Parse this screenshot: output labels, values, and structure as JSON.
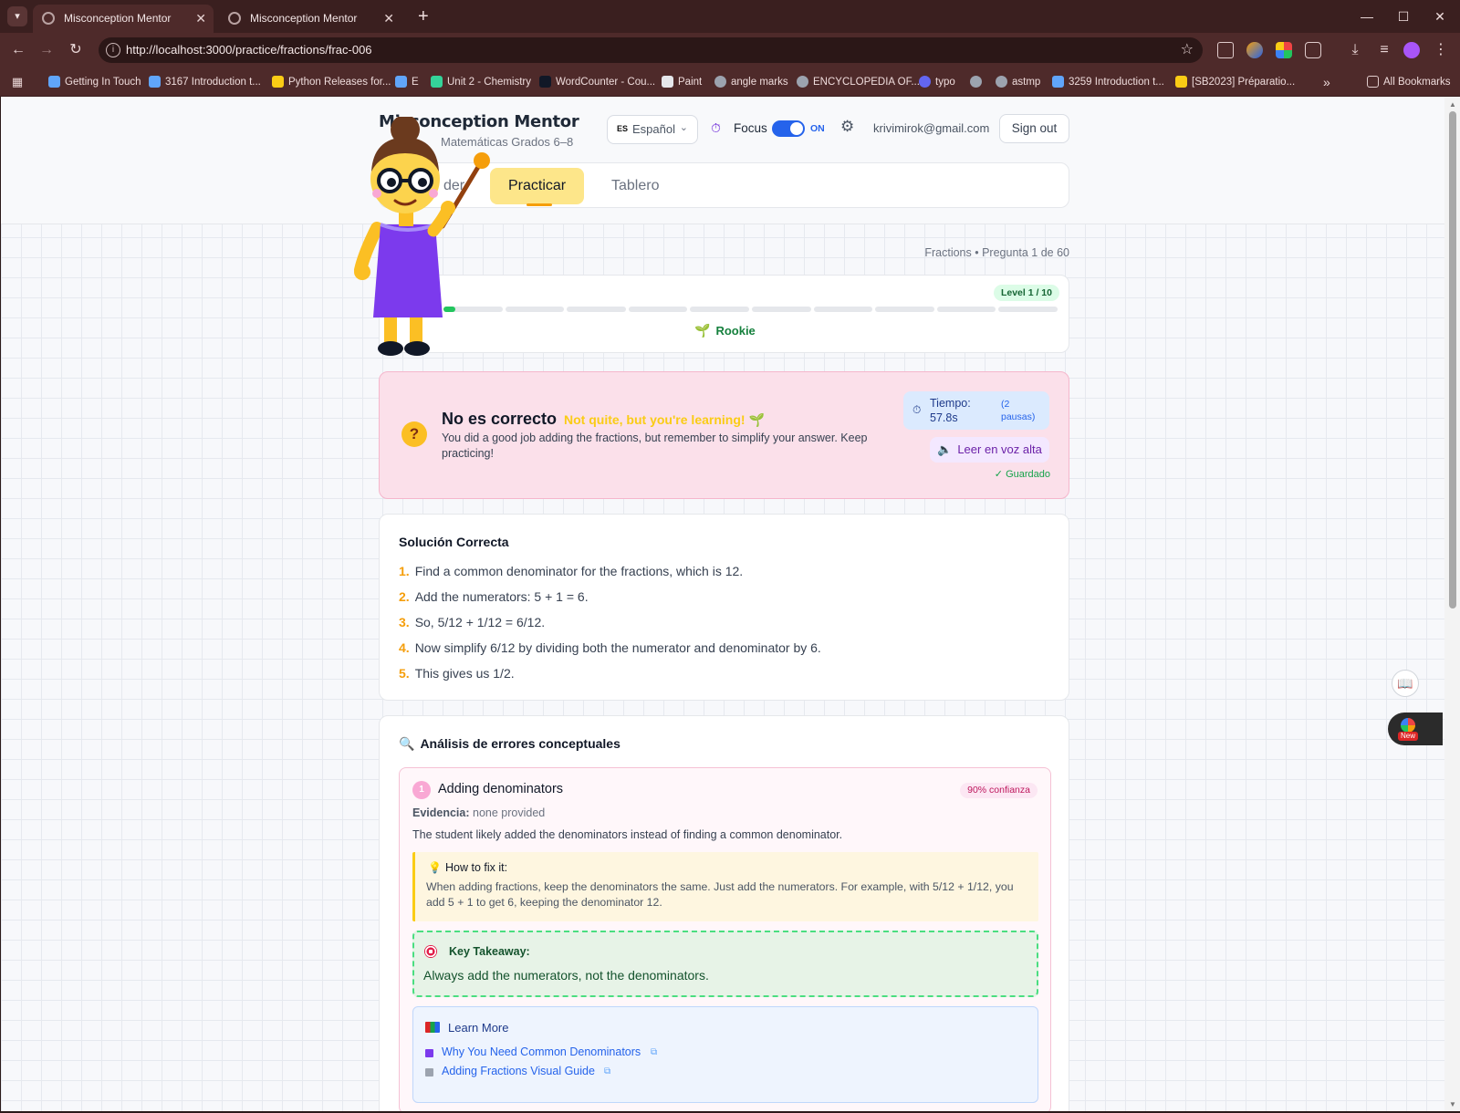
{
  "browser": {
    "tabs": [
      {
        "title": "Misconception Mentor",
        "active": true
      },
      {
        "title": "Misconception Mentor",
        "active": false
      }
    ],
    "url": "http://localhost:3000/practice/fractions/frac-006",
    "bookmarks": [
      {
        "label": "Getting In Touch",
        "color": "#60a5fa"
      },
      {
        "label": "3167 Introduction t...",
        "color": "#60a5fa"
      },
      {
        "label": "Python Releases for...",
        "color": "#facc15"
      },
      {
        "label": "E",
        "color": "#60a5fa"
      },
      {
        "label": "Unit 2 - Chemistry",
        "color": "#34d399"
      },
      {
        "label": "WordCounter - Cou...",
        "color": "#111827"
      },
      {
        "label": "Paint",
        "color": "#e5e7eb"
      },
      {
        "label": "angle marks",
        "color": "#9ca3af"
      },
      {
        "label": "ENCYCLOPEDIA OF...",
        "color": "#9ca3af"
      },
      {
        "label": "typo",
        "color": "#6366f1"
      },
      {
        "label": "",
        "color": "#9ca3af"
      },
      {
        "label": "astmp",
        "color": "#9ca3af"
      },
      {
        "label": "3259 Introduction t...",
        "color": "#60a5fa"
      },
      {
        "label": "[SB2023] Préparatio...",
        "color": "#facc15"
      }
    ],
    "all_bookmarks": "All Bookmarks",
    "overflow": "»"
  },
  "app": {
    "title": "Misconception Mentor",
    "subtitle": "Matemáticas Grados 6–8",
    "language": {
      "code": "ES",
      "label": "Español"
    },
    "focus": {
      "label": "Focus",
      "state": "ON"
    },
    "user_email": "krivimirok@gmail.com",
    "sign_out": "Sign out",
    "nav": [
      {
        "label": "der",
        "active": false
      },
      {
        "label": "Practicar",
        "active": true
      },
      {
        "label": "Tablero",
        "active": false
      }
    ]
  },
  "progress": {
    "breadcrumb": "Fractions • Pregunta 1 de 60",
    "level_badge": "Level 1 / 10",
    "level": 1,
    "levels_total": 10,
    "level_fraction": 0.02,
    "rank": "Rookie"
  },
  "feedback": {
    "title": "No es correcto",
    "encouragement": "Not quite, but you're learning! 🌱",
    "message": "You did a good job adding the fractions, but remember to simplify your answer. Keep practicing!",
    "timer_label": "Tiempo: 57.8s",
    "pauses": "(2 pausas)",
    "read_aloud": "Leer en voz alta",
    "saved": "✓ Guardado"
  },
  "solution": {
    "title": "Solución Correcta",
    "steps": [
      {
        "num": "1.",
        "text": "Find a common denominator for the fractions, which is 12."
      },
      {
        "num": "2.",
        "text": "Add the numerators: 5 + 1 = 6."
      },
      {
        "num": "3.",
        "text": "So, 5/12 + 1/12 = 6/12."
      },
      {
        "num": "4.",
        "text": "Now simplify 6/12 by dividing both the numerator and denominator by 6."
      },
      {
        "num": "5.",
        "text": "This gives us 1/2."
      }
    ]
  },
  "analysis": {
    "title": "Análisis de errores conceptuales",
    "items": [
      {
        "num": "1",
        "title": "Adding denominators",
        "confidence": "90% confianza",
        "evidence_label": "Evidencia:",
        "evidence": "none provided",
        "description": "The student likely added the denominators instead of finding a common denominator.",
        "fix_title": "How to fix it:",
        "fix_body": "When adding fractions, keep the denominators the same. Just add the numerators. For example, with 5/12 + 1/12, you add 5 + 1 to get 6, keeping the denominator 12.",
        "takeaway_title": "Key Takeaway:",
        "takeaway_body": "Always add the numerators, not the denominators.",
        "learn_title": "Learn More",
        "links": [
          "Why You Need Common Denominators",
          "Adding Fractions Visual Guide"
        ]
      }
    ]
  },
  "side": {
    "new_label": "New"
  }
}
